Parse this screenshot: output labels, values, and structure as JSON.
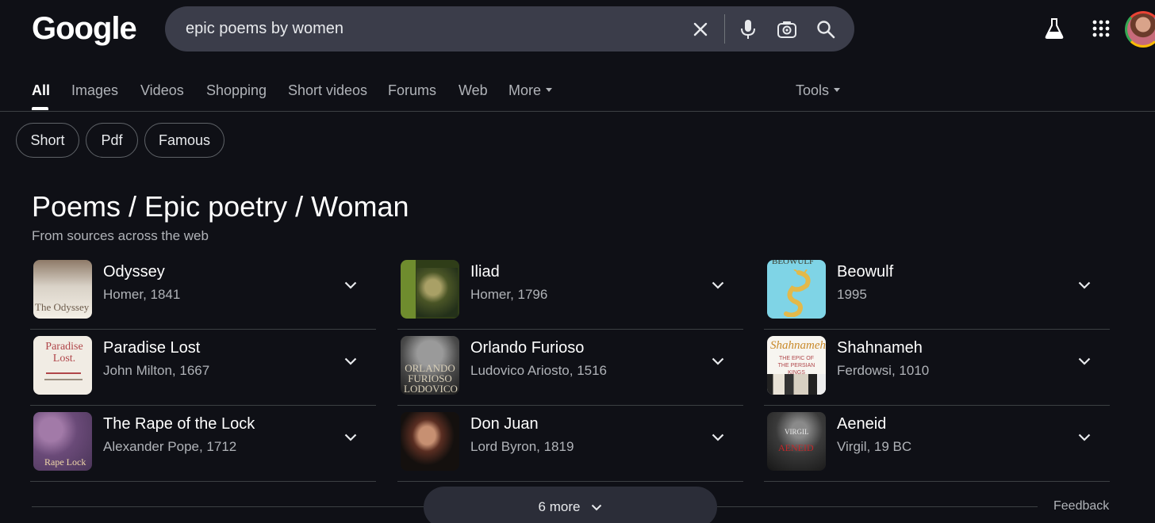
{
  "logo": "Google",
  "search": {
    "query": "epic poems by women"
  },
  "tabs": [
    {
      "label": "All"
    },
    {
      "label": "Images"
    },
    {
      "label": "Videos"
    },
    {
      "label": "Shopping"
    },
    {
      "label": "Short videos"
    },
    {
      "label": "Forums"
    },
    {
      "label": "Web"
    },
    {
      "label": "More"
    }
  ],
  "tools_label": "Tools",
  "chips": [
    {
      "label": "Short"
    },
    {
      "label": "Pdf"
    },
    {
      "label": "Famous"
    }
  ],
  "panel": {
    "title": "Poems / Epic poetry / Woman",
    "subtitle": "From sources across the web",
    "items": [
      {
        "title": "Odyssey",
        "subtitle": "Homer, 1841",
        "cover_text": "The Odyssey"
      },
      {
        "title": "Iliad",
        "subtitle": "Homer, 1796"
      },
      {
        "title": "Beowulf",
        "subtitle": "1995",
        "cover_text": "BEOWULF"
      },
      {
        "title": "Paradise Lost",
        "subtitle": "John Milton, 1667",
        "cover_text": "Paradise Lost."
      },
      {
        "title": "Orlando Furioso",
        "subtitle": "Ludovico Ariosto, 1516",
        "cover_text": "ORLANDO FURIOSO LODOVICO"
      },
      {
        "title": "Shahnameh",
        "subtitle": "Ferdowsi, 1010",
        "cover_text": "Shahnameh",
        "cover_subtext": "THE EPIC OF THE PERSIAN KINGS"
      },
      {
        "title": "The Rape of the Lock",
        "subtitle": "Alexander Pope, 1712",
        "cover_text": "Rape Lock"
      },
      {
        "title": "Don Juan",
        "subtitle": "Lord Byron, 1819"
      },
      {
        "title": "Aeneid",
        "subtitle": "Virgil, 19 BC",
        "cover_text": "VIRGIL",
        "cover_subtext": "AENEID"
      }
    ]
  },
  "more_button": "6 more",
  "feedback": "Feedback",
  "colors": {
    "background": "#0f1016",
    "search_bar": "#3b3d4a",
    "text_primary": "#ffffff",
    "text_secondary": "#b0b3b8"
  }
}
